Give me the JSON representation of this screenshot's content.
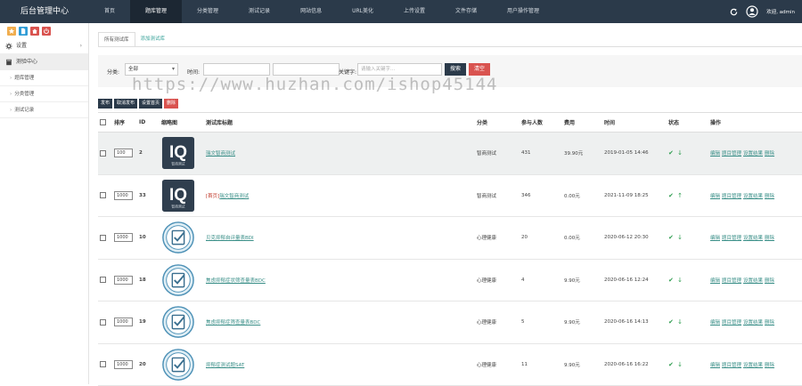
{
  "app": {
    "title": "后台管理中心"
  },
  "topnav": {
    "items": [
      "首页",
      "题库管理",
      "分类管理",
      "测试记录",
      "网站信息",
      "URL美化",
      "上传设置",
      "文件存储",
      "用户操作管理"
    ],
    "active_index": 1,
    "welcome": "欢迎, admin"
  },
  "sidebar": {
    "quick_buttons": [
      {
        "icon": "star-icon",
        "color": "#f0ad4e"
      },
      {
        "icon": "file-icon",
        "color": "#2f9cd6"
      },
      {
        "icon": "home-icon",
        "color": "#d9534f"
      },
      {
        "icon": "power-icon",
        "color": "#d9534f"
      }
    ],
    "settings_label": "设置",
    "test_center_label": "测验中心",
    "sub_items": [
      "题库管理",
      "分类管理",
      "测试记录"
    ]
  },
  "tabs": {
    "all": "所有测试库",
    "add": "添加测试库"
  },
  "filter": {
    "category_label": "分类:",
    "category_value": "全部",
    "time_label": "时间:",
    "keyword_label": "关键字:",
    "keyword_placeholder": "请输入关键字...",
    "search_button": "搜索",
    "clear_button": "清空"
  },
  "actions": {
    "publish": "发布",
    "unpublish": "取消发布",
    "set_home": "设置首页",
    "delete": "删除"
  },
  "table": {
    "headers": [
      "排序",
      "ID",
      "缩略图",
      "测试库标题",
      "分类",
      "参与人数",
      "费用",
      "时间",
      "状态",
      "操作"
    ],
    "rows": [
      {
        "sort": "100",
        "id": "2",
        "thumb": "iq",
        "title": "瑞文智商测试",
        "home_tag": "",
        "category": "智商测试",
        "participants": "431",
        "fee": "39.90元",
        "time": "2019-01-05 14:46",
        "status": "✔ ↓",
        "highlight": true
      },
      {
        "sort": "1000",
        "id": "33",
        "thumb": "iq",
        "title": "瑞文智商测试",
        "home_tag": "[首页]",
        "category": "智商测试",
        "participants": "346",
        "fee": "0.00元",
        "time": "2021-11-09 18:25",
        "status": "✔ ↑",
        "highlight": false
      },
      {
        "sort": "1000",
        "id": "10",
        "thumb": "check",
        "title": "贝克抑郁自评量表BDI",
        "home_tag": "",
        "category": "心理健康",
        "participants": "20",
        "fee": "0.00元",
        "time": "2020-06-12 20:30",
        "status": "✔ ↓",
        "highlight": false
      },
      {
        "sort": "1000",
        "id": "18",
        "thumb": "check",
        "title": "焦虑抑郁症状筛查量表BDC",
        "home_tag": "",
        "category": "心理健康",
        "participants": "4",
        "fee": "9.90元",
        "time": "2020-06-16 12:24",
        "status": "✔ ↓",
        "highlight": false
      },
      {
        "sort": "1000",
        "id": "19",
        "thumb": "check",
        "title": "焦虑抑郁症筛查量表BDC",
        "home_tag": "",
        "category": "心理健康",
        "participants": "5",
        "fee": "9.90元",
        "time": "2020-06-16 14:13",
        "status": "✔ ↓",
        "highlight": false
      },
      {
        "sort": "1000",
        "id": "20",
        "thumb": "check",
        "title": "抑郁症测试题SAT",
        "home_tag": "",
        "category": "心理健康",
        "participants": "11",
        "fee": "9.90元",
        "time": "2020-06-16 16:22",
        "status": "✔ ↓",
        "highlight": false
      }
    ],
    "ops": [
      "编辑",
      "题目管理",
      "设置结果",
      "删除"
    ],
    "iq_text": "IQ",
    "iq_sub": "智商测试"
  },
  "watermark": "https://www.huzhan.com/ishop45144"
}
